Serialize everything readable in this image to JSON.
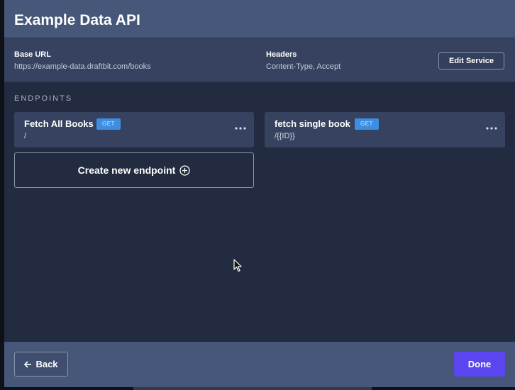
{
  "modal": {
    "title": "Example Data API"
  },
  "service": {
    "base_url_label": "Base URL",
    "base_url_value": "https://example-data.draftbit.com/books",
    "headers_label": "Headers",
    "headers_value": "Content-Type, Accept",
    "edit_label": "Edit Service"
  },
  "endpoints": {
    "section_label": "ENDPOINTS",
    "items": [
      {
        "name": "Fetch All Books",
        "method": "GET",
        "path": "/",
        "menu_icon": "more-horizontal-icon"
      },
      {
        "name": "fetch single book",
        "method": "GET",
        "path": "/{{ID}}",
        "menu_icon": "more-horizontal-icon"
      }
    ],
    "create_label": "Create new endpoint",
    "create_icon": "plus-circle-icon"
  },
  "footer": {
    "back_label": "Back",
    "back_icon": "arrow-left-icon",
    "done_label": "Done"
  },
  "colors": {
    "accent": "#5b45f0",
    "badge": "#3c8fe0",
    "header": "#465779",
    "panel": "#232b40"
  }
}
